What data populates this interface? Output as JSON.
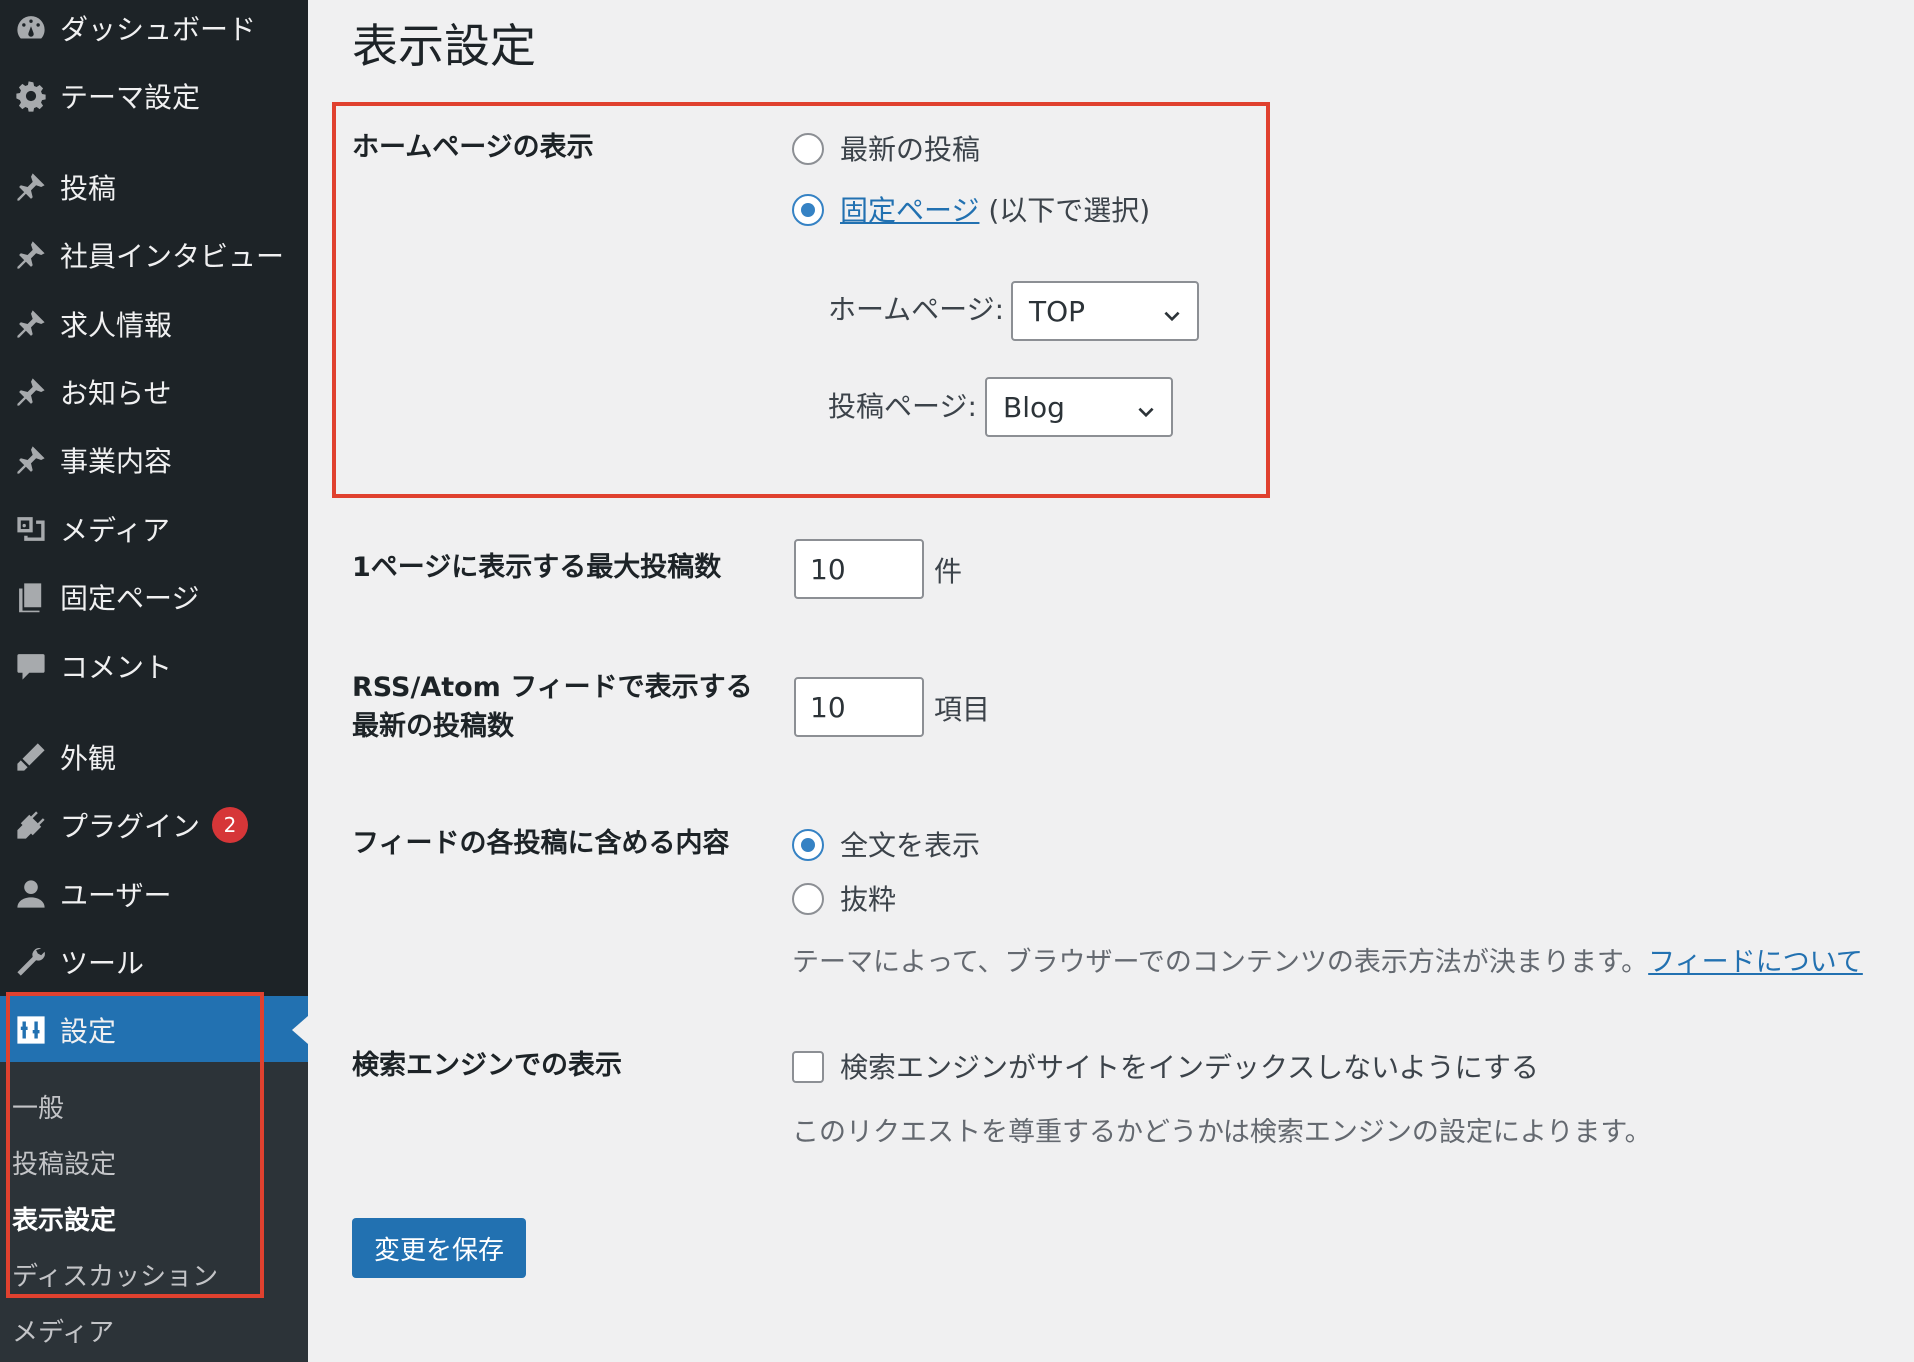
{
  "sidebar": {
    "items": [
      {
        "label": "ダッシュボード",
        "icon": "dashboard-icon"
      },
      {
        "label": "テーマ設定",
        "icon": "gear-icon"
      },
      {
        "label": "投稿",
        "icon": "pin-icon"
      },
      {
        "label": "社員インタビュー",
        "icon": "pin-icon"
      },
      {
        "label": "求人情報",
        "icon": "pin-icon"
      },
      {
        "label": "お知らせ",
        "icon": "pin-icon"
      },
      {
        "label": "事業内容",
        "icon": "pin-icon"
      },
      {
        "label": "メディア",
        "icon": "media-icon"
      },
      {
        "label": "固定ページ",
        "icon": "page-icon"
      },
      {
        "label": "コメント",
        "icon": "comment-icon"
      },
      {
        "label": "外観",
        "icon": "appearance-icon"
      },
      {
        "label": "プラグイン",
        "icon": "plugin-icon",
        "badge": "2"
      },
      {
        "label": "ユーザー",
        "icon": "user-icon"
      },
      {
        "label": "ツール",
        "icon": "wrench-icon"
      },
      {
        "label": "設定",
        "icon": "settings-icon"
      }
    ],
    "submenu": [
      "一般",
      "投稿設定",
      "表示設定",
      "ディスカッション",
      "メディア"
    ]
  },
  "main": {
    "title": "表示設定",
    "homepage_display": {
      "label": "ホームページの表示",
      "option_latest": "最新の投稿",
      "option_static_link": "固定ページ",
      "option_static_suffix": " (以下で選択)",
      "homepage_label": "ホームページ:",
      "homepage_value": "TOP",
      "posts_page_label": "投稿ページ:",
      "posts_page_value": "Blog"
    },
    "posts_per_page": {
      "label": "1ページに表示する最大投稿数",
      "value": "10",
      "unit": "件"
    },
    "feed_items": {
      "label_line1": "RSS/Atom フィードで表示する",
      "label_line2": "最新の投稿数",
      "value": "10",
      "unit": "項目"
    },
    "feed_content": {
      "label": "フィードの各投稿に含める内容",
      "option_full": "全文を表示",
      "option_excerpt": "抜粋",
      "description": "テーマによって、ブラウザーでのコンテンツの表示方法が決まります。",
      "description_link": "フィードについて"
    },
    "search_engine": {
      "label": "検索エンジンでの表示",
      "checkbox_label": "検索エンジンがサイトをインデックスしないようにする",
      "description": "このリクエストを尊重するかどうかは検索エンジンの設定によります。"
    },
    "save_label": "変更を保存"
  },
  "colors": {
    "sidebar_bg": "#1d2327",
    "submenu_bg": "#2c3338",
    "accent": "#2271b1",
    "highlight_box": "#e0412f",
    "badge": "#d63638"
  }
}
